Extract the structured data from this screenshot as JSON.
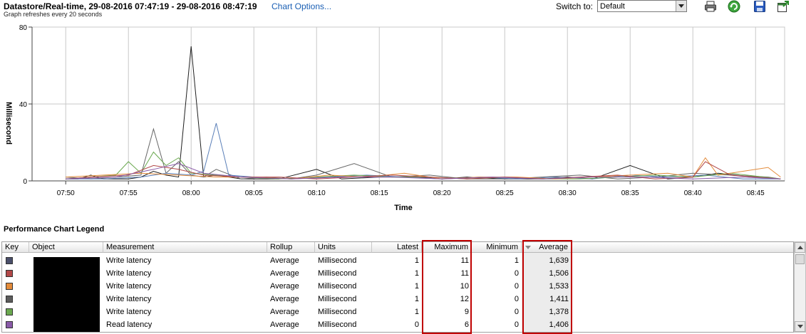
{
  "header": {
    "title": "Datastore/Real-time, 29-08-2016 07:47:19 - 29-08-2016 08:47:19",
    "chart_options_link": "Chart Options...",
    "subtitle": "Graph refreshes every 20 seconds",
    "switch_to_label": "Switch to:",
    "switch_to_value": "Default"
  },
  "toolbar": {
    "print_icon": "printer-icon",
    "refresh_icon": "refresh-icon",
    "save_icon": "save-icon",
    "popout_icon": "popout-icon"
  },
  "chart_data": {
    "type": "line",
    "ylabel": "Millisecond",
    "xlabel": "Time",
    "yticks": [
      "0",
      "40",
      "80"
    ],
    "ylim": [
      0,
      80
    ],
    "xticks": [
      "07:50",
      "07:55",
      "08:00",
      "08:05",
      "08:10",
      "08:15",
      "08:20",
      "08:25",
      "08:30",
      "08:35",
      "08:40",
      "08:45"
    ],
    "grid": true,
    "series": [
      {
        "color": "#1e1e1e",
        "x": [
          "07:50",
          "07:51",
          "07:52",
          "07:53",
          "07:54",
          "07:55",
          "07:56",
          "07:57",
          "07:58",
          "07:59",
          "08:00",
          "08:01",
          "08:02",
          "08:03",
          "08:04",
          "08:05",
          "08:07",
          "08:10",
          "08:12",
          "08:15",
          "08:18",
          "08:20",
          "08:22",
          "08:25",
          "08:28",
          "08:30",
          "08:32",
          "08:35",
          "08:38",
          "08:40",
          "08:42",
          "08:45",
          "08:47"
        ],
        "values": [
          1,
          1,
          3,
          1,
          1,
          1,
          2,
          5,
          3,
          2,
          70,
          2,
          3,
          2,
          1,
          1,
          1,
          6,
          1,
          2,
          2,
          1,
          2,
          1,
          1,
          2,
          1,
          8,
          1,
          2,
          4,
          2,
          1
        ]
      },
      {
        "color": "#666666",
        "x": [
          "07:50",
          "07:52",
          "07:54",
          "07:56",
          "07:57",
          "07:58",
          "07:59",
          "08:00",
          "08:01",
          "08:02",
          "08:04",
          "08:06",
          "08:08",
          "08:10",
          "08:13",
          "08:16",
          "08:19",
          "08:22",
          "08:25",
          "08:28",
          "08:31",
          "08:34",
          "08:37",
          "08:40",
          "08:43",
          "08:46",
          "08:47"
        ],
        "values": [
          2,
          1,
          2,
          3,
          27,
          4,
          10,
          3,
          2,
          6,
          1,
          2,
          1,
          3,
          9,
          2,
          3,
          1,
          1,
          2,
          3,
          1,
          2,
          4,
          3,
          2,
          1
        ]
      },
      {
        "color": "#5a7fb8",
        "x": [
          "07:50",
          "07:53",
          "07:56",
          "07:58",
          "08:00",
          "08:01",
          "08:02",
          "08:03",
          "08:05",
          "08:08",
          "08:11",
          "08:14",
          "08:17",
          "08:20",
          "08:23",
          "08:26",
          "08:29",
          "08:32",
          "08:35",
          "08:38",
          "08:41",
          "08:44",
          "08:47"
        ],
        "values": [
          1,
          1,
          2,
          4,
          3,
          5,
          30,
          3,
          2,
          1,
          2,
          3,
          2,
          1,
          2,
          1,
          2,
          1,
          3,
          2,
          3,
          1,
          1
        ]
      },
      {
        "color": "#6aa84f",
        "x": [
          "07:50",
          "07:52",
          "07:54",
          "07:55",
          "07:56",
          "07:57",
          "07:58",
          "07:59",
          "08:00",
          "08:02",
          "08:04",
          "08:07",
          "08:10",
          "08:13",
          "08:16",
          "08:19",
          "08:22",
          "08:25",
          "08:28",
          "08:31",
          "08:34",
          "08:37",
          "08:40",
          "08:43",
          "08:47"
        ],
        "values": [
          1,
          2,
          3,
          10,
          4,
          15,
          8,
          12,
          4,
          3,
          2,
          1,
          2,
          3,
          2,
          2,
          1,
          2,
          1,
          1,
          2,
          3,
          2,
          4,
          1
        ]
      },
      {
        "color": "#e38b3a",
        "x": [
          "07:50",
          "07:53",
          "07:56",
          "07:59",
          "08:02",
          "08:05",
          "08:08",
          "08:11",
          "08:14",
          "08:17",
          "08:20",
          "08:23",
          "08:26",
          "08:29",
          "08:32",
          "08:35",
          "08:38",
          "08:40",
          "08:41",
          "08:42",
          "08:44",
          "08:46",
          "08:47"
        ],
        "values": [
          2,
          3,
          4,
          3,
          2,
          2,
          1,
          3,
          2,
          4,
          1,
          2,
          2,
          1,
          2,
          3,
          4,
          2,
          12,
          3,
          5,
          7,
          2
        ]
      },
      {
        "color": "#b24848",
        "x": [
          "07:50",
          "07:52",
          "07:55",
          "07:57",
          "07:59",
          "08:01",
          "08:04",
          "08:07",
          "08:10",
          "08:13",
          "08:16",
          "08:19",
          "08:22",
          "08:25",
          "08:28",
          "08:31",
          "08:34",
          "08:37",
          "08:40",
          "08:41",
          "08:43",
          "08:45",
          "08:47"
        ],
        "values": [
          1,
          2,
          3,
          8,
          6,
          3,
          2,
          2,
          1,
          2,
          3,
          2,
          1,
          2,
          1,
          2,
          3,
          1,
          2,
          10,
          3,
          2,
          1
        ]
      },
      {
        "color": "#8a5aa8",
        "x": [
          "07:50",
          "07:54",
          "07:57",
          "07:59",
          "08:01",
          "08:04",
          "08:08",
          "08:12",
          "08:16",
          "08:20",
          "08:24",
          "08:28",
          "08:32",
          "08:36",
          "08:40",
          "08:44",
          "08:47"
        ],
        "values": [
          1,
          2,
          6,
          9,
          4,
          2,
          1,
          2,
          2,
          1,
          2,
          1,
          2,
          2,
          1,
          2,
          1
        ]
      }
    ]
  },
  "legend": {
    "title": "Performance Chart Legend",
    "columns": {
      "key": "Key",
      "object": "Object",
      "measurement": "Measurement",
      "rollup": "Rollup",
      "units": "Units",
      "latest": "Latest",
      "maximum": "Maximum",
      "minimum": "Minimum",
      "average": "Average"
    },
    "sort_indicator_icon": "sort-descending-icon",
    "rows": [
      {
        "key_color": "#4a4f6a",
        "measurement": "Write latency",
        "rollup": "Average",
        "units": "Millisecond",
        "latest": "1",
        "maximum": "11",
        "minimum": "1",
        "average": "1,639"
      },
      {
        "key_color": "#b24848",
        "measurement": "Write latency",
        "rollup": "Average",
        "units": "Millisecond",
        "latest": "1",
        "maximum": "11",
        "minimum": "0",
        "average": "1,506"
      },
      {
        "key_color": "#e38b3a",
        "measurement": "Write latency",
        "rollup": "Average",
        "units": "Millisecond",
        "latest": "1",
        "maximum": "10",
        "minimum": "0",
        "average": "1,533"
      },
      {
        "key_color": "#5c5c5c",
        "measurement": "Write latency",
        "rollup": "Average",
        "units": "Millisecond",
        "latest": "1",
        "maximum": "12",
        "minimum": "0",
        "average": "1,411"
      },
      {
        "key_color": "#6aa84f",
        "measurement": "Write latency",
        "rollup": "Average",
        "units": "Millisecond",
        "latest": "1",
        "maximum": "9",
        "minimum": "0",
        "average": "1,378"
      },
      {
        "key_color": "#8a5aa8",
        "measurement": "Read latency",
        "rollup": "Average",
        "units": "Millisecond",
        "latest": "0",
        "maximum": "6",
        "minimum": "0",
        "average": "1,406"
      }
    ]
  }
}
